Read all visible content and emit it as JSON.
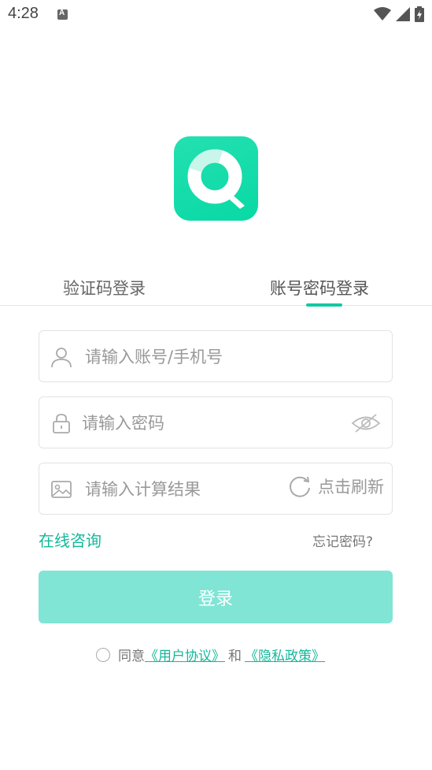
{
  "status_bar": {
    "time": "4:28"
  },
  "tabs": [
    {
      "label": "验证码登录"
    },
    {
      "label": "账号密码登录"
    }
  ],
  "form": {
    "account_placeholder": "请输入账号/手机号",
    "password_placeholder": "请输入密码",
    "captcha_placeholder": "请输入计算结果",
    "refresh_label": "点击刷新"
  },
  "links": {
    "consult": "在线咨询",
    "forgot": "忘记密码?"
  },
  "login_button": "登录",
  "agreement": {
    "prefix": "同意",
    "user_agreement": "《用户协议》",
    "and": "和",
    "privacy_policy": "《隐私政策》"
  },
  "colors": {
    "accent": "#13c9a3",
    "button_bg": "#80e5d5",
    "link": "#13b89a"
  }
}
